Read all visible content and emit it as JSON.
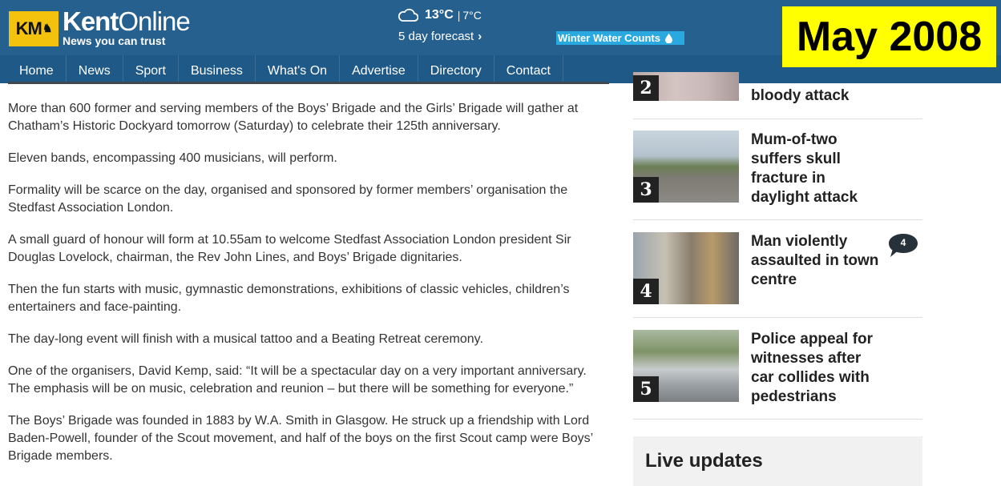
{
  "header": {
    "logo_mark": "KM",
    "brand_bold": "Kent",
    "brand_light": "Online",
    "tagline": "News you can trust",
    "weather": {
      "icon": "cloud-icon",
      "temp_high": "13°C",
      "separator": "|",
      "temp_low": "7°C",
      "forecast_label": "5 day forecast",
      "forecast_chevron": "›"
    },
    "promo": {
      "label": "Winter Water Counts",
      "icon": "water-drop-icon"
    }
  },
  "date_badge": "May 2008",
  "nav": {
    "items": [
      "Home",
      "News",
      "Sport",
      "Business",
      "What's On",
      "Advertise",
      "Directory",
      "Contact"
    ]
  },
  "article": {
    "paragraphs": [
      "More than 600 former and serving members of the Boys’ Brigade and the Girls’ Brigade will gather at Chatham’s Historic Dockyard tomorrow (Saturday) to celebrate their 125th anniversary.",
      "Eleven bands, encompassing 400 musicians, will perform.",
      "Formality will be scarce on the day, organised and sponsored by former members’ organisation the Stedfast Association London.",
      "A small guard of honour will form at 10.55am to welcome Stedfast Association London president Sir Douglas Lovelock, chairman, the Rev John Lines, and Boys’ Brigade dignitaries.",
      "Then the fun starts with music, gymnastic demonstrations, exhibitions of classic vehicles, children’s entertainers and face-painting.",
      "The day-long event will finish with a musical tattoo and a Beating Retreat ceremony.",
      "One of the organisers, David Kemp, said: “It will be a spectacular day on a very important anniversary. The emphasis will be on music, celebration and reunion – but there will be something for everyone.”",
      "The Boys’ Brigade was founded in 1883 by W.A. Smith in Glasgow. He struck up a friendship with Lord Baden-Powell, founder of the Scout movement, and half of the boys on the first Scout camp were Boys’ Brigade members."
    ]
  },
  "sidebar": {
    "items": [
      {
        "rank": "2",
        "title": "bloody attack"
      },
      {
        "rank": "3",
        "title": "Mum-of-two suffers skull fracture in daylight attack"
      },
      {
        "rank": "4",
        "title": "Man violently assaulted in town centre",
        "comments": "4"
      },
      {
        "rank": "5",
        "title": "Police appeal for witnesses after car collides with pedestrians"
      }
    ],
    "live_title": "Live updates"
  }
}
